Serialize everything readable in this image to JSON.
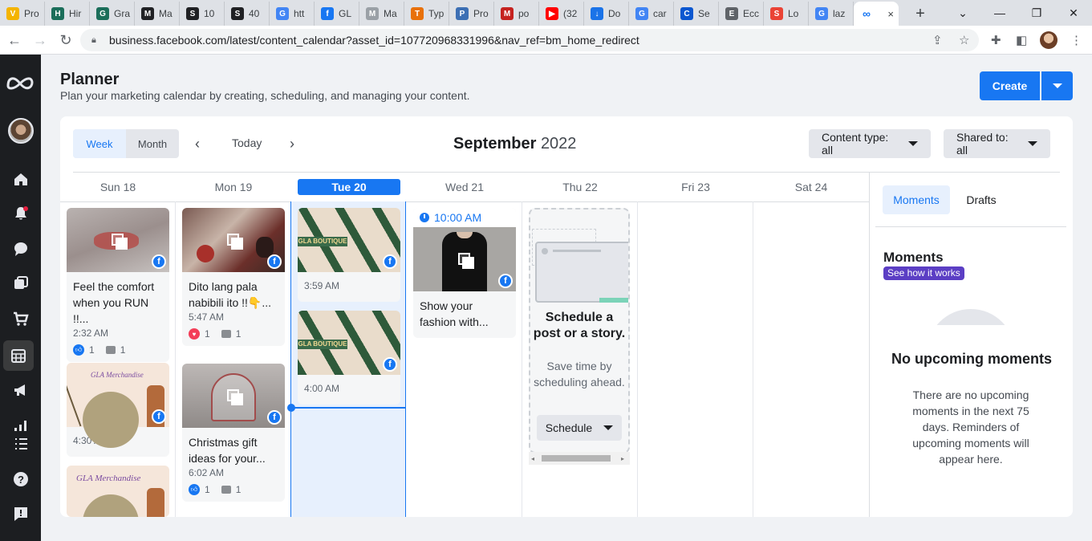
{
  "browser": {
    "tabs": [
      {
        "label": "Pro",
        "color": "#f4b400",
        "glyph": "V"
      },
      {
        "label": "Hir",
        "color": "#1b6e5a",
        "glyph": "H"
      },
      {
        "label": "Gra",
        "color": "#1b6e5a",
        "glyph": "G"
      },
      {
        "label": "Ma",
        "color": "#202124",
        "glyph": "M"
      },
      {
        "label": "10",
        "color": "#202124",
        "glyph": "S"
      },
      {
        "label": "40",
        "color": "#202124",
        "glyph": "S"
      },
      {
        "label": "htt",
        "color": "#4285f4",
        "glyph": "G"
      },
      {
        "label": "GL",
        "color": "#1877f2",
        "glyph": "f"
      },
      {
        "label": "Ma",
        "color": "#9aa0a6",
        "glyph": "M"
      },
      {
        "label": "Typ",
        "color": "#e8710a",
        "glyph": "T"
      },
      {
        "label": "Pro",
        "color": "#3c6fb4",
        "glyph": "P"
      },
      {
        "label": "po",
        "color": "#c5221f",
        "glyph": "M"
      },
      {
        "label": "(32",
        "color": "#ff0000",
        "glyph": "▶"
      },
      {
        "label": "Do",
        "color": "#1a73e8",
        "glyph": "↓"
      },
      {
        "label": "car",
        "color": "#4285f4",
        "glyph": "G"
      },
      {
        "label": "Se",
        "color": "#0b57d0",
        "glyph": "C"
      },
      {
        "label": "Ecc",
        "color": "#5f6368",
        "glyph": "E"
      },
      {
        "label": "Lo",
        "color": "#ea4335",
        "glyph": "S"
      },
      {
        "label": "laz",
        "color": "#4285f4",
        "glyph": "G"
      }
    ],
    "active_tab_close": "×",
    "new_tab": "+",
    "url": "business.facebook.com/latest/content_calendar?asset_id=107720968331996&nav_ref=bm_home_redirect"
  },
  "header": {
    "title": "Planner",
    "subtitle": "Plan your marketing calendar by creating, scheduling, and managing your content.",
    "create_label": "Create"
  },
  "toolbar": {
    "week_label": "Week",
    "month_label": "Month",
    "today_label": "Today",
    "month_name": "September",
    "year": "2022",
    "content_type_filter": "Content type: all",
    "shared_to_filter": "Shared to: all"
  },
  "days": [
    {
      "label": "Sun 18",
      "today": false
    },
    {
      "label": "Mon 19",
      "today": false
    },
    {
      "label": "Tue 20",
      "today": true
    },
    {
      "label": "Wed 21",
      "today": false
    },
    {
      "label": "Thu 22",
      "today": false
    },
    {
      "label": "Fri 23",
      "today": false
    },
    {
      "label": "Sat 24",
      "today": false
    }
  ],
  "posts": {
    "sun1": {
      "text1": "Feel the comfort",
      "text2": "when you RUN !!...",
      "time": "2:32 AM",
      "likes": "1",
      "comments": "1"
    },
    "sun2": {
      "time": "4:30 AM",
      "brand": "GLA Merchandise"
    },
    "sun3": {
      "brand": "GLA Merchandise"
    },
    "mon1": {
      "text1": "Dito lang pala",
      "text2": "nabibili ito !!👇...",
      "time": "5:47 AM",
      "likes": "1",
      "comments": "1"
    },
    "mon2": {
      "text1": "Christmas gift",
      "text2": "ideas for your...",
      "time": "6:02 AM",
      "likes": "1",
      "comments": "1"
    },
    "tue1": {
      "time": "3:59 AM",
      "brand": "GLA BOUTIQUE"
    },
    "tue2": {
      "time": "4:00 AM",
      "brand": "GLA BOUTIQUE"
    },
    "wed1": {
      "scheduled": "10:00 AM",
      "text1": "Show your",
      "text2": "fashion with..."
    }
  },
  "schedule_prompt": {
    "title": "Schedule a post or a story.",
    "description": "Save time by scheduling ahead.",
    "button": "Schedule"
  },
  "right_panel": {
    "tab_moments": "Moments",
    "tab_drafts": "Drafts",
    "heading": "Moments",
    "see_how": "See how it works",
    "empty_title": "No upcoming moments",
    "empty_text": "There are no upcoming moments in the next 75 days. Reminders of upcoming moments will appear here."
  },
  "colors": {
    "brand": "#1877f2",
    "rail": "#1c1e21",
    "see_how": "#5b3ec4"
  }
}
